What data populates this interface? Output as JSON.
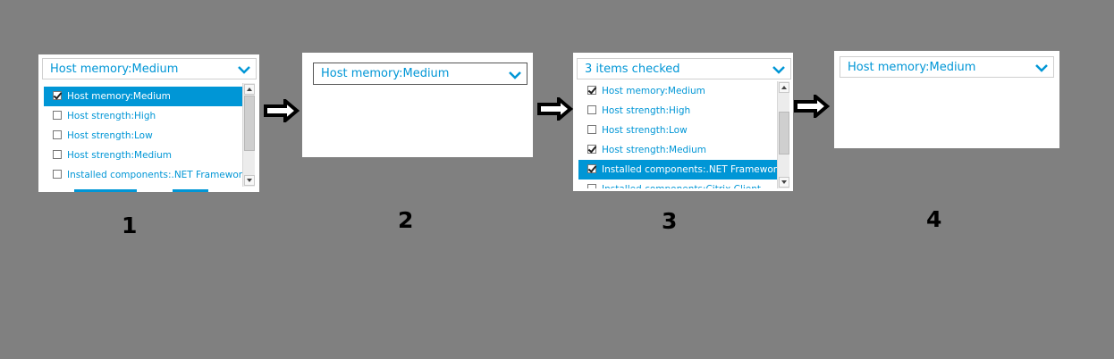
{
  "panel1": {
    "selected_text": "Host memory:Medium",
    "items": [
      {
        "label": "Host memory:Medium",
        "checked": true,
        "highlighted": true
      },
      {
        "label": "Host strength:High",
        "checked": false,
        "highlighted": false
      },
      {
        "label": "Host strength:Low",
        "checked": false,
        "highlighted": false
      },
      {
        "label": "Host strength:Medium",
        "checked": false,
        "highlighted": false
      },
      {
        "label": "Installed components:.NET Framework",
        "checked": false,
        "highlighted": false
      }
    ]
  },
  "panel2": {
    "selected_text": "Host memory:Medium"
  },
  "panel3": {
    "selected_text": "3 items checked",
    "items": [
      {
        "label": "Host memory:Medium",
        "checked": true,
        "highlighted": false
      },
      {
        "label": "Host strength:High",
        "checked": false,
        "highlighted": false
      },
      {
        "label": "Host strength:Low",
        "checked": false,
        "highlighted": false
      },
      {
        "label": "Host strength:Medium",
        "checked": true,
        "highlighted": false
      },
      {
        "label": "Installed components:.NET Framework",
        "checked": true,
        "highlighted": true
      },
      {
        "label": "Installed components:Citrix Client",
        "checked": false,
        "highlighted": false
      }
    ]
  },
  "panel4": {
    "selected_text": "Host memory:Medium"
  },
  "steps": [
    "1",
    "2",
    "3",
    "4"
  ],
  "colors": {
    "background": "#808080",
    "accent": "#0096d6",
    "arrow": "#000000"
  },
  "icons": {
    "dropdown": "chevron-down-icon",
    "next": "arrow-right-icon"
  }
}
